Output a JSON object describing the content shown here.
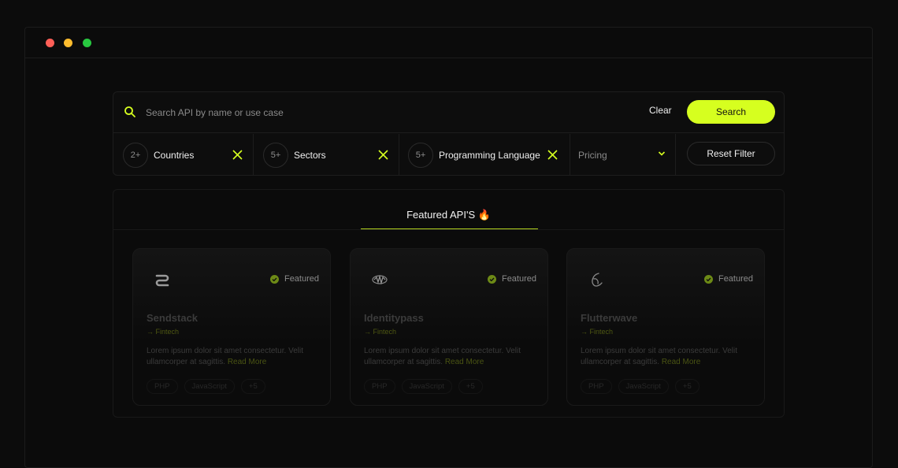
{
  "search": {
    "placeholder": "Search API by name or use case",
    "clear_label": "Clear",
    "search_label": "Search"
  },
  "filters": {
    "chips": [
      {
        "count": "2+",
        "label": "Countries"
      },
      {
        "count": "5+",
        "label": "Sectors"
      },
      {
        "count": "5+",
        "label": "Programming Language"
      }
    ],
    "pricing_label": "Pricing",
    "reset_label": "Reset Filter"
  },
  "featured": {
    "title": "Featured API'S 🔥",
    "cards": [
      {
        "logo": "sendstack-logo",
        "badge": "Featured",
        "name": "Sendstack",
        "category": "→ Fintech",
        "desc": "Lorem ipsum dolor sit amet consectetur. Velit ullamcorper at sagittis.",
        "read_more": "Read More",
        "tags": [
          "PHP",
          "JavaScript",
          "+5"
        ]
      },
      {
        "logo": "identitypass-logo",
        "badge": "Featured",
        "name": "Identitypass",
        "category": "→ Fintech",
        "desc": "Lorem ipsum dolor sit amet consectetur. Velit ullamcorper at sagittis.",
        "read_more": "Read More",
        "tags": [
          "PHP",
          "JavaScript",
          "+5"
        ]
      },
      {
        "logo": "flutterwave-logo",
        "badge": "Featured",
        "name": "Flutterwave",
        "category": "→ Fintech",
        "desc": "Lorem ipsum dolor sit amet consectetur. Velit ullamcorper at sagittis.",
        "read_more": "Read More",
        "tags": [
          "PHP",
          "JavaScript",
          "+5"
        ]
      }
    ]
  },
  "colors": {
    "accent": "#d6ff1f",
    "background": "#0c0c0c"
  }
}
